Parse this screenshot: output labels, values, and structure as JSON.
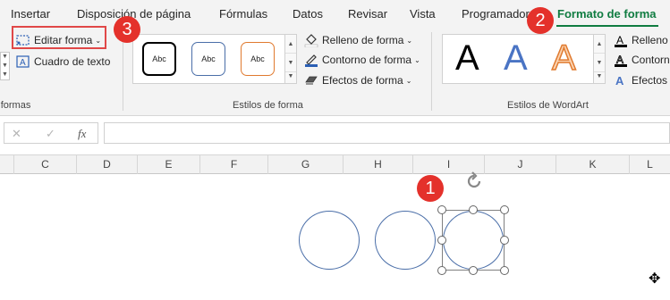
{
  "tabs": [
    "Insertar",
    "Disposición de página",
    "Fórmulas",
    "Datos",
    "Revisar",
    "Vista",
    "Programador",
    "Formato de forma"
  ],
  "active_tab": "Formato de forma",
  "insert_shapes_group": {
    "label": "r formas",
    "edit_shape": "Editar forma",
    "text_box": "Cuadro de texto"
  },
  "shape_styles_group": {
    "label": "Estilos de forma",
    "style_samples": [
      "Abc",
      "Abc",
      "Abc"
    ],
    "fill": "Relleno de forma",
    "outline": "Contorno de forma",
    "effects": "Efectos de forma"
  },
  "wordart_group": {
    "label": "Estilos de WordArt",
    "letters": [
      "A",
      "A",
      "A"
    ],
    "fill": "Relleno d",
    "outline": "Contorno",
    "effects": "Efectos d"
  },
  "formula_bar": {
    "cancel_icon": "✕",
    "enter_icon": "✓",
    "fx_label": "fx",
    "value": ""
  },
  "columns": [
    "C",
    "D",
    "E",
    "F",
    "G",
    "H",
    "I",
    "J",
    "K",
    "L"
  ],
  "callouts": [
    "1",
    "2",
    "3"
  ],
  "colors": {
    "accent": "#107c41",
    "callout": "#e4312b",
    "highlight": "#e04848",
    "shape_outline": "#4a6ea8"
  }
}
